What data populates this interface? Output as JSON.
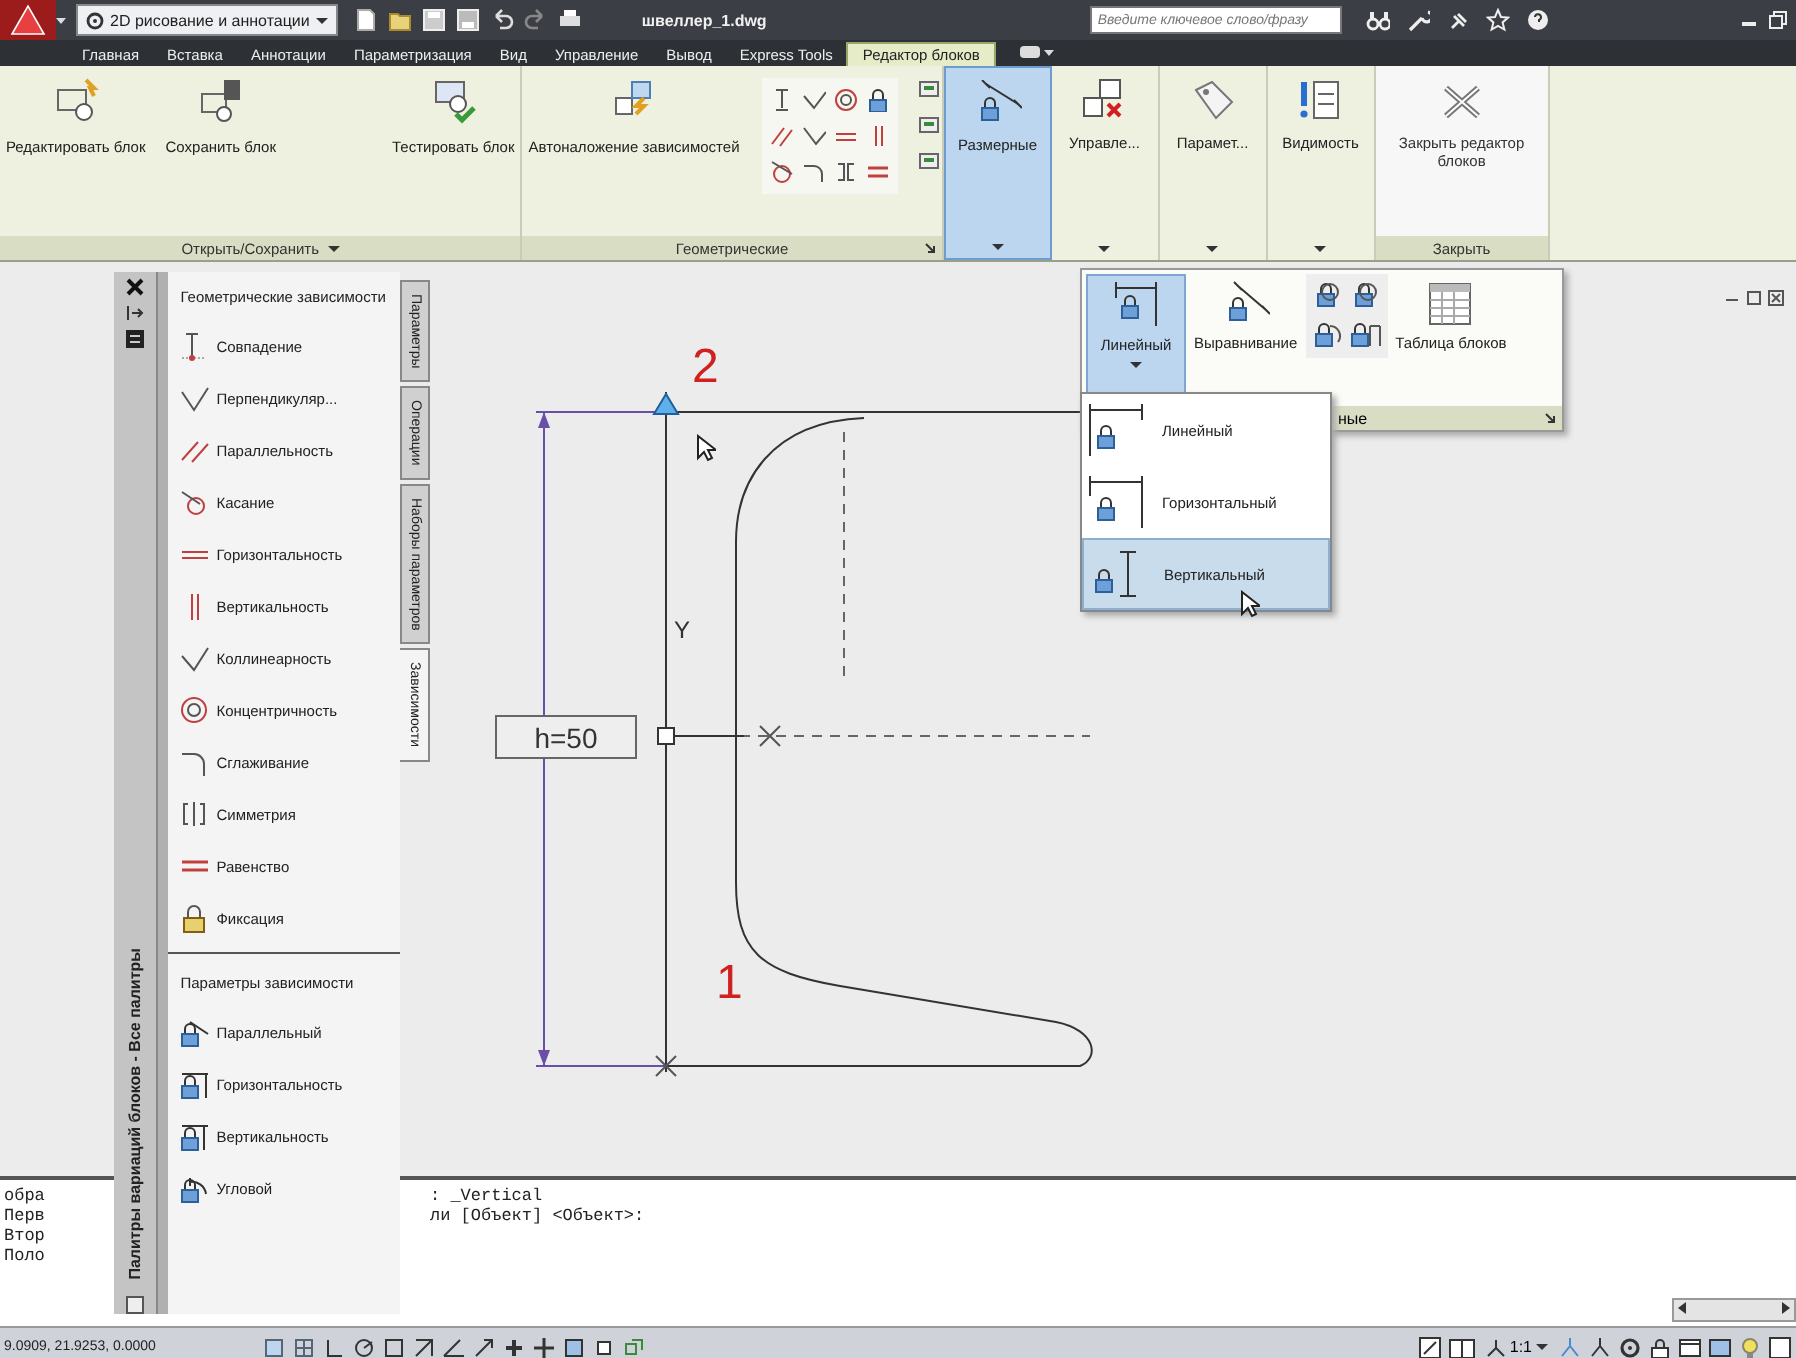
{
  "title_bar": {
    "workspace": "2D рисование и аннотации",
    "document_title": "швеллер_1.dwg",
    "search": {
      "placeholder": "Введите ключевое слово/фразу"
    }
  },
  "ribbon_tabs": [
    {
      "label": "Главная",
      "selected": false
    },
    {
      "label": "Вставка",
      "selected": false
    },
    {
      "label": "Аннотации",
      "selected": false
    },
    {
      "label": "Параметризация",
      "selected": false
    },
    {
      "label": "Вид",
      "selected": false
    },
    {
      "label": "Управление",
      "selected": false
    },
    {
      "label": "Вывод",
      "selected": false
    },
    {
      "label": "Express Tools",
      "selected": false
    },
    {
      "label": "Редактор блоков",
      "selected": true
    }
  ],
  "ribbon_panels": [
    {
      "title": "Открыть/Сохранить",
      "menu": true,
      "launcher": false,
      "buttons": [
        "Редактировать блок",
        "Сохранить блок",
        "Тестировать блок"
      ]
    },
    {
      "title": "Геометрические",
      "menu": false,
      "launcher": true,
      "buttons": [
        "Автоналожение зависимостей"
      ]
    }
  ],
  "collapsed_panels": [
    {
      "label": "Размерные",
      "selected": true
    },
    {
      "label": "Управле...",
      "selected": false
    },
    {
      "label": "Парамет...",
      "selected": false
    },
    {
      "label": "Видимость",
      "selected": false
    }
  ],
  "close_panel": {
    "title": "Закрыть",
    "button": "Закрыть редактор блоков"
  },
  "dimension_flyout": {
    "buttons": [
      {
        "label": "Линейный",
        "expanded": true
      },
      {
        "label": "Выравнивание",
        "expanded": false
      },
      {
        "label": "Таблица блоков",
        "expanded": false
      }
    ],
    "footer": "ные"
  },
  "linear_menu": [
    {
      "label": "Линейный",
      "selected": false
    },
    {
      "label": "Горизонтальный",
      "selected": false
    },
    {
      "label": "Вертикальный",
      "selected": true
    }
  ],
  "palette": {
    "title": "Палитры вариаций блоков - Все палитры",
    "tabs": [
      {
        "label": "Параметры",
        "selected": false
      },
      {
        "label": "Операции",
        "selected": false
      },
      {
        "label": "Наборы параметров",
        "selected": false
      },
      {
        "label": "Зависимости",
        "selected": true
      }
    ],
    "sections": [
      {
        "title": "Геометрические зависимости",
        "items": [
          "Совпадение",
          "Перпендикуляр...",
          "Параллельность",
          "Касание",
          "Горизонтальность",
          "Вертикальность",
          "Коллинеарность",
          "Концентричность",
          "Сглаживание",
          "Симметрия",
          "Равенство",
          "Фиксация"
        ]
      },
      {
        "title": "Параметры зависимости",
        "items": [
          "Параллельный",
          "Горизонтальность",
          "Вертикальность",
          "Угловой"
        ]
      }
    ]
  },
  "drawing": {
    "dimension_value": "h=50",
    "point_labels": [
      "2",
      "1"
    ],
    "axis_label": "Y"
  },
  "command_line": [
    {
      "prefix": "обра",
      "text": ": _Vertical"
    },
    {
      "prefix": "Перв",
      "text": "ли [Объект] <Объект>:"
    },
    {
      "prefix": "Втор"
    },
    {
      "prefix": "Поло"
    }
  ],
  "status_bar": {
    "coordinates": "9.0909, 21.9253, 0.0000",
    "annotation_scale": "1:1"
  }
}
